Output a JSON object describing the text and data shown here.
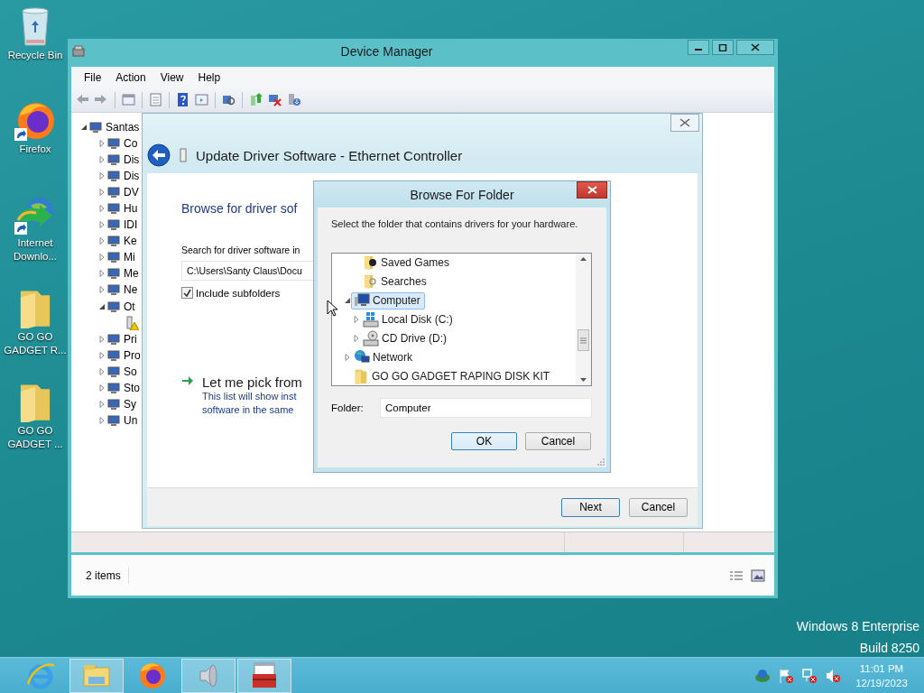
{
  "desktop_icons": [
    {
      "label": "Recycle Bin",
      "kind": "bin",
      "shortcut": false
    },
    {
      "label": "Firefox",
      "kind": "firefox",
      "shortcut": true
    },
    {
      "label": "Internet Downlo...",
      "kind": "download",
      "shortcut": true
    },
    {
      "label": "GO GO GADGET R...",
      "kind": "folder",
      "shortcut": false
    },
    {
      "label": "GO GO GADGET ...",
      "kind": "folder",
      "shortcut": false
    }
  ],
  "device_manager": {
    "title": "Device Manager",
    "menu": [
      "File",
      "Action",
      "View",
      "Help"
    ],
    "tree": {
      "label": "Santas",
      "expanded": true,
      "children": [
        {
          "label": "Co",
          "expanded": false
        },
        {
          "label": "Dis",
          "expanded": false
        },
        {
          "label": "Dis",
          "expanded": false
        },
        {
          "label": "DV",
          "expanded": false
        },
        {
          "label": "Hu",
          "expanded": false
        },
        {
          "label": "IDI",
          "expanded": false
        },
        {
          "label": "Ke",
          "expanded": false
        },
        {
          "label": "Mi",
          "expanded": false
        },
        {
          "label": "Me",
          "expanded": false
        },
        {
          "label": "Ne",
          "expanded": false
        },
        {
          "label": "Ot",
          "expanded": true,
          "children": [
            {
              "warning": true
            }
          ]
        },
        {
          "label": "Pri",
          "expanded": false
        },
        {
          "label": "Pro",
          "expanded": false
        },
        {
          "label": "So",
          "expanded": false
        },
        {
          "label": "Sto",
          "expanded": false
        },
        {
          "label": "Sy",
          "expanded": false
        },
        {
          "label": "Un",
          "expanded": false
        }
      ]
    },
    "status": "2 items"
  },
  "update_driver": {
    "title": "Update Driver Software - Ethernet Controller",
    "heading": "Browse for driver sof",
    "search_label": "Search for driver software in",
    "path": "C:\\Users\\Santy Claus\\Docu",
    "include_subfolders": {
      "label": "Include subfolders",
      "checked": true
    },
    "pick_link": "Let me pick from",
    "pick_description": [
      "This list will show inst",
      "software in the same"
    ],
    "buttons": [
      "Next",
      "Cancel"
    ]
  },
  "browse_folder": {
    "title": "Browse For Folder",
    "instruction": "Select the folder that contains drivers for your hardware.",
    "continued_children": [
      {
        "label": "Saved Games",
        "kind": "saved-games",
        "selected": false
      },
      {
        "label": "Searches",
        "kind": "searches",
        "selected": false
      }
    ],
    "items": [
      {
        "label": "Computer",
        "kind": "computer",
        "selected": true,
        "expanded": true,
        "children": [
          {
            "label": "Local Disk (C:)",
            "kind": "disk",
            "selected": false,
            "expanded": false
          },
          {
            "label": "CD Drive (D:)",
            "kind": "cd",
            "selected": false,
            "expanded": false
          }
        ]
      },
      {
        "label": "Network",
        "kind": "network",
        "selected": false,
        "expanded": false
      },
      {
        "label": "GO GO GADGET RAPING DISK KIT",
        "kind": "folder",
        "selected": false
      }
    ],
    "folder_label": "Folder:",
    "folder_value": "Computer",
    "buttons": [
      "OK",
      "Cancel"
    ]
  },
  "os_edition": [
    "Windows 8 Enterprise",
    "Build 8250"
  ],
  "taskbar": {
    "apps": [
      {
        "kind": "ie",
        "running": false
      },
      {
        "kind": "explorer",
        "running": true
      },
      {
        "kind": "firefox",
        "running": false
      },
      {
        "kind": "speaker",
        "running": true
      },
      {
        "kind": "toolbox",
        "running": true
      }
    ],
    "time": "11:01 PM",
    "date": "12/19/2023"
  }
}
